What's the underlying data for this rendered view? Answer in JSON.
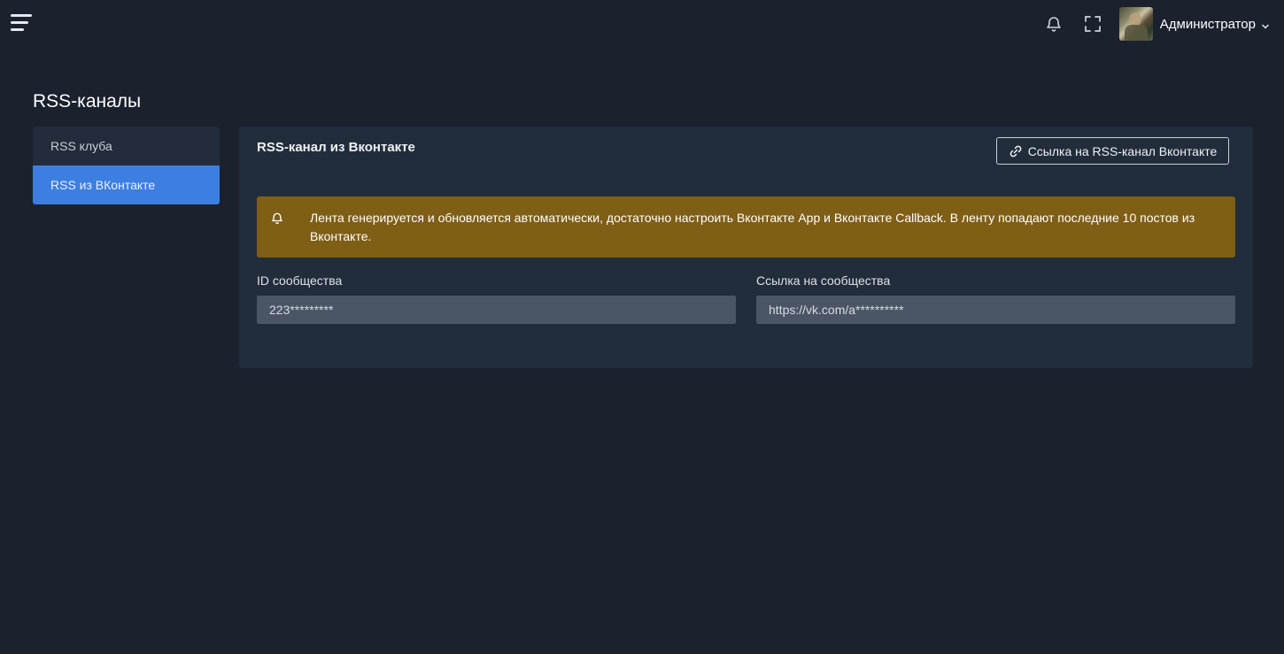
{
  "header": {
    "user_name": "Администратор",
    "icons": [
      "menu-icon",
      "bell-icon",
      "fullscreen-icon",
      "chevron-down-icon"
    ]
  },
  "page": {
    "title": "RSS-каналы"
  },
  "sidebar": {
    "items": [
      {
        "label": "RSS клуба",
        "active": false
      },
      {
        "label": "RSS из ВКонтакте",
        "active": true
      }
    ]
  },
  "card": {
    "title": "RSS-канал из Вконтакте",
    "link_button_label": "Ссылка на RSS-канал Вконтакте",
    "alert_text": "Лента генерируется и обновляется автоматически, достаточно настроить Вконтакте App и Вконтакте Callback. В ленту попадают последние 10 постов из Вконтакте.",
    "fields": {
      "community_id": {
        "label": "ID сообщества",
        "value": "223*********"
      },
      "community_link": {
        "label": "Ссылка на сообщества",
        "value": "https://vk.com/a**********"
      }
    }
  },
  "colors": {
    "background": "#1b212d",
    "card": "#222d3c",
    "active_nav": "#3d7fe0",
    "alert": "#7f5e16",
    "input": "#4a5565"
  }
}
